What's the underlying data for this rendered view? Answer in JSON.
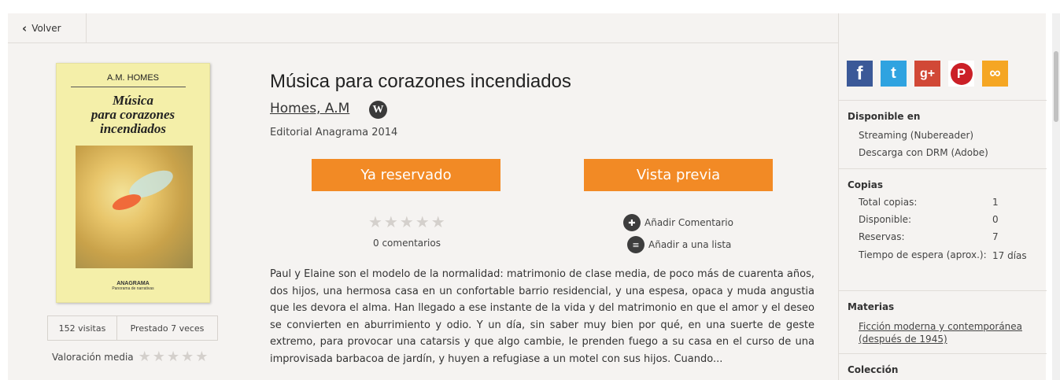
{
  "nav": {
    "back_label": "Volver"
  },
  "cover": {
    "author": "A.M. HOMES",
    "title": "Música\npara corazones\nincendiados",
    "publisher_logo": "ANAGRAMA",
    "collection": "Panorama de narrativas"
  },
  "stats": {
    "visits": "152 visitas",
    "loans": "Prestado 7 veces"
  },
  "rating": {
    "average_label": "Valoración media",
    "average_stars": 0,
    "user_stars": 0
  },
  "book": {
    "title": "Música para corazones incendiados",
    "author": "Homes, A.M",
    "wiki_letter": "W",
    "publisher": "Editorial Anagrama 2014",
    "description": "Paul y Elaine son el modelo de la normalidad: matrimonio de clase media, de poco más de cuarenta años, dos hijos, una hermosa casa en un confortable barrio residencial, y una espesa, opaca y muda angustia que les devora el alma. Han llegado a ese instante de la vida y del matrimonio en que el amor y el deseo se convierten en aburrimiento y odio. Y un día, sin saber muy bien por qué, en una suerte de geste extremo, para provocar una catarsis y que algo cambie, le prenden fuego a su casa en el curso de una improvisada barbacoa de jardín, y huyen a refugiase a un motel con sus hijos. Cuando..."
  },
  "actions": {
    "reserved_label": "Ya reservado",
    "preview_label": "Vista previa",
    "comments_count": "0 comentarios",
    "add_comment": "Añadir Comentario",
    "add_to_list": "Añadir a una lista"
  },
  "sidebar": {
    "social": [
      "facebook-icon",
      "twitter-icon",
      "google-plus-icon",
      "pinterest-icon",
      "link-icon"
    ],
    "available": {
      "heading": "Disponible en",
      "items": [
        "Streaming (Nubereader)",
        "Descarga con DRM (Adobe)"
      ]
    },
    "copies": {
      "heading": "Copias",
      "rows": [
        {
          "label": "Total copias:",
          "value": "1"
        },
        {
          "label": "Disponible:",
          "value": "0"
        },
        {
          "label": "Reservas:",
          "value": "7"
        },
        {
          "label": "Tiempo de espera (aprox.):",
          "value": "17 días"
        }
      ]
    },
    "subjects": {
      "heading": "Materias",
      "link": "Ficción moderna y contemporánea (después de 1945)"
    },
    "collection": {
      "heading": "Colección"
    }
  },
  "colors": {
    "accent": "#f28a25",
    "background": "#f5f3f1"
  }
}
